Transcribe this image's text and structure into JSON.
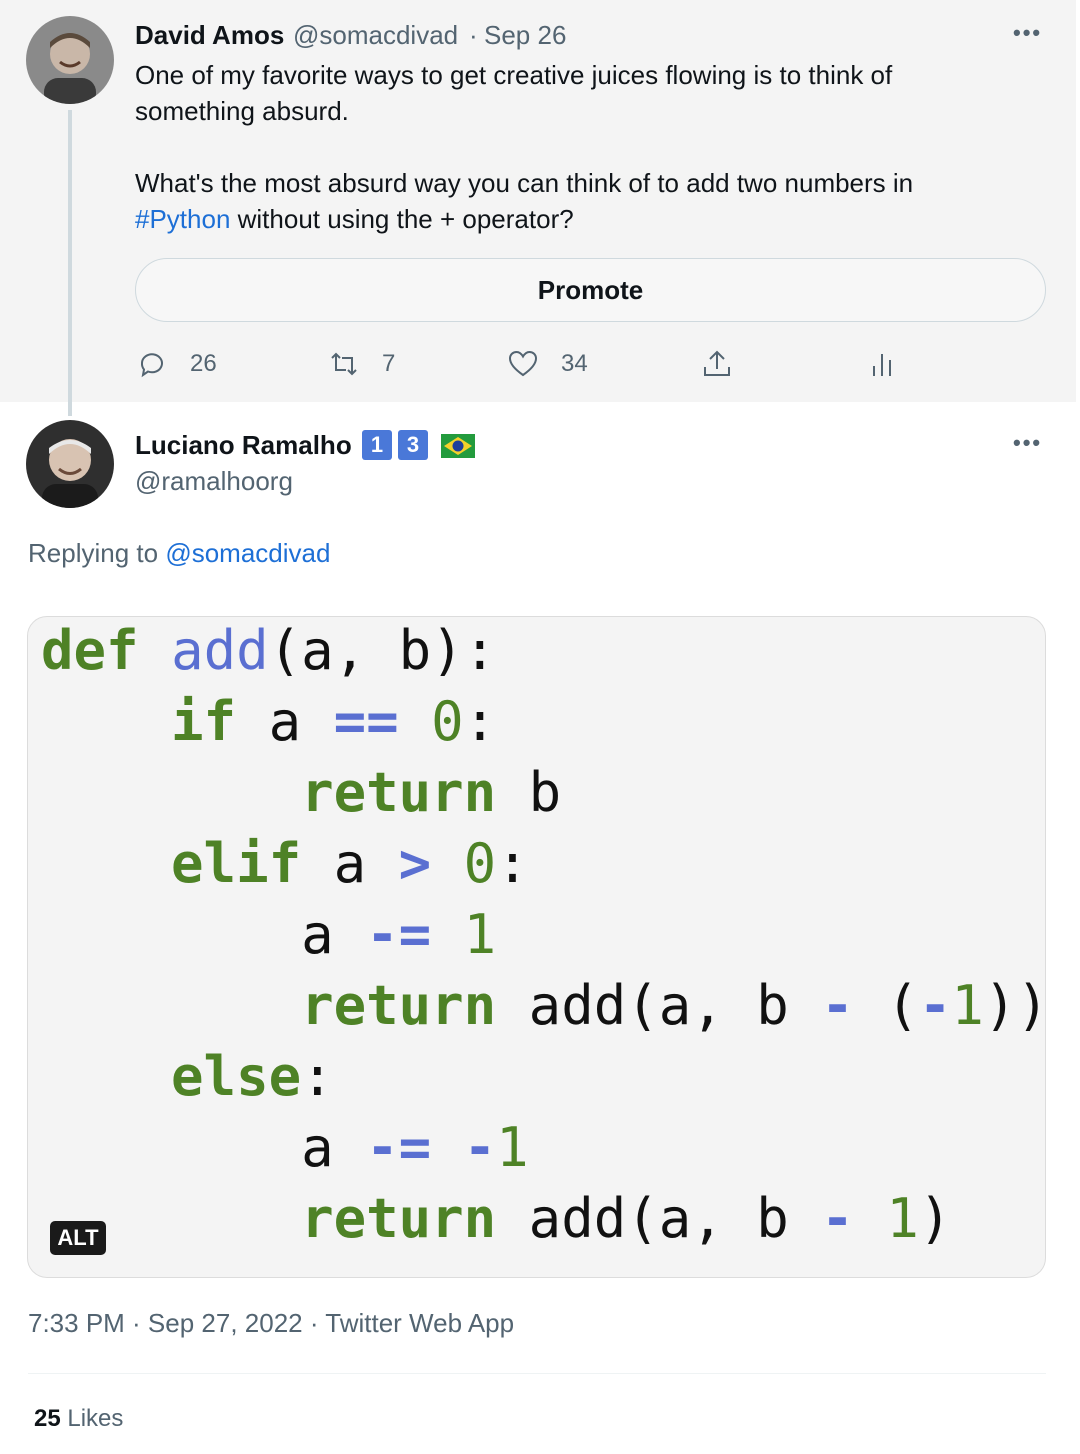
{
  "parent_tweet": {
    "author_name": "David Amos",
    "author_handle": "@somacdivad",
    "date_separator": "·",
    "date": "Sep 26",
    "more_icon": "more-horizontal-icon",
    "text_line1": "One of my favorite ways to get creative juices flowing is to think of",
    "text_line2": "something absurd.",
    "text_line3": "What's the most absurd way you can think of to add two numbers in",
    "hashtag": "#Python",
    "text_line4_rest": " without using the + operator?",
    "promote_label": "Promote",
    "actions": {
      "reply_count": "26",
      "retweet_count": "7",
      "like_count": "34"
    }
  },
  "reply_tweet": {
    "author_name": "Luciano Ramalho",
    "badge1": "1",
    "badge2": "3",
    "flag_icon": "brazil-flag-icon",
    "author_handle": "@ramalhoorg",
    "replying_prefix": "Replying to ",
    "replying_to": "@somacdivad",
    "alt_label": "ALT",
    "code_lines": [
      "def add(a, b):",
      "    if a == 0:",
      "        return b",
      "    elif a > 0:",
      "        a -= 1",
      "        return add(a, b - (-1))",
      "    else:",
      "        a -= -1",
      "        return add(a, b - 1)"
    ],
    "timestamp": "7:33 PM · Sep 27, 2022 · Twitter Web App",
    "likes_count": "25",
    "likes_label": "Likes"
  },
  "colors": {
    "link": "#1d6fd6",
    "keyword": "#4e8226",
    "function": "#5a6fd1",
    "badge": "#4a78d8"
  }
}
